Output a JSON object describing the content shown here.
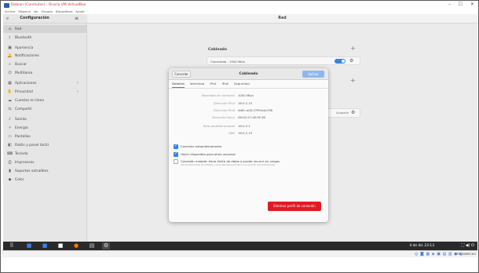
{
  "vbox": {
    "title": "Debian (Conmutar) - Oracle VM VirtualBox",
    "menu": [
      "Archivo",
      "Máquina",
      "Ver",
      "Entrada",
      "Dispositivos",
      "Ayuda"
    ],
    "window_controls": [
      "–",
      "☐",
      "✕"
    ]
  },
  "settings": {
    "header_title": "Configuración",
    "page_title": "Red"
  },
  "sidebar": {
    "items": [
      {
        "icon": "⌂",
        "label": "Red",
        "active": true
      },
      {
        "icon": "ᛒ",
        "label": "Bluetooth"
      },
      {
        "icon": "▣",
        "label": "Apariencia"
      },
      {
        "icon": "🔔",
        "label": "Notificaciones"
      },
      {
        "icon": "⌕",
        "label": "Buscar"
      },
      {
        "icon": "⌬",
        "label": "Multitarea"
      },
      {
        "icon": "▦",
        "label": "Aplicaciones",
        "chevron": "›"
      },
      {
        "icon": "✋",
        "label": "Privacidad",
        "chevron": "›"
      },
      {
        "icon": "☁",
        "label": "Cuentas en línea"
      },
      {
        "icon": "⇆",
        "label": "Compartir"
      },
      {
        "icon": "♪",
        "label": "Sonido"
      },
      {
        "icon": "⚡",
        "label": "Energía"
      },
      {
        "icon": "▭",
        "label": "Pantallas"
      },
      {
        "icon": "◧",
        "label": "Ratón y panel táctil"
      },
      {
        "icon": "⌨",
        "label": "Teclado"
      },
      {
        "icon": "⎙",
        "label": "Impresoras"
      },
      {
        "icon": "▮",
        "label": "Soportes extraíbles"
      },
      {
        "icon": "◆",
        "label": "Color"
      }
    ]
  },
  "main": {
    "wired_section": "Cableado",
    "wired_status": "Conectado - 1000 Mb/s",
    "wired_enabled": true,
    "proxy_status": "Apagado"
  },
  "dialog": {
    "cancel": "Cancelar",
    "title": "Cableado",
    "apply": "Aplicar",
    "tabs": [
      "Detalles",
      "Identidad",
      "IPv4",
      "IPv6",
      "Seguridad"
    ],
    "selected_tab": "Detalles",
    "details": [
      {
        "key": "Velocidad de conexión",
        "value": "1000 Mb/s"
      },
      {
        "key": "Dirección IPv4",
        "value": "16.0.2.15"
      },
      {
        "key": "Dirección IPv6",
        "value": "fe80::a00:27ff:fe4e:f38"
      },
      {
        "key": "Dirección física",
        "value": "08:00:27:4E:0F:38"
      },
      {
        "key": "Ruta predeterminada",
        "value": "16.0.2.1"
      },
      {
        "key": "DNS",
        "value": "16.0.2.15"
      }
    ],
    "auto_connect": {
      "label": "Conectar automáticamente",
      "checked": true
    },
    "available_all": {
      "label": "Hacer disponible para otros usuarios",
      "checked": true
    },
    "metered": {
      "label": "Conexión medida: tiene límite de datos o puede incurrir en cargas",
      "sublabel": "Las actualizaciones de software y otras descargas grandes no se iniciarán automáticamente.",
      "checked": false
    },
    "remove": "Eliminar perfil de conexión"
  },
  "taskbar": {
    "apps": [
      {
        "icon": "⠿",
        "color": "#ffffff"
      },
      {
        "icon": "■",
        "color": "#3a7fdc"
      },
      {
        "icon": "■",
        "color": "#3584e4"
      },
      {
        "icon": "■",
        "color": "#ffffff"
      },
      {
        "icon": "●",
        "color": "#f57c00"
      },
      {
        "icon": "▤",
        "color": "#cccccc"
      },
      {
        "icon": "⚙",
        "color": "#dddddd",
        "active": true
      }
    ],
    "clock": "4 de dic  23:13",
    "tray": "⛶  ◀)  ⏻"
  },
  "host_status": {
    "icons": "◎ ◙ ▦ ◈ ▣ ▤ ▥ ◉ ◍",
    "hostkey": "CTRL DERECHO"
  },
  "colors": {
    "accent": "#3584e4",
    "destructive": "#e01b24"
  }
}
